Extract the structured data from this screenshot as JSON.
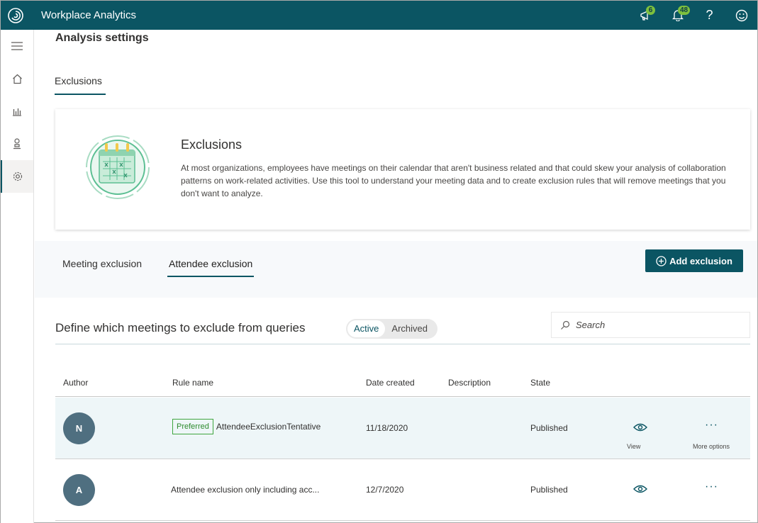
{
  "app": {
    "title": "Workplace Analytics"
  },
  "header": {
    "megaphone_count": "6",
    "bell_count": "48",
    "help_label": "?"
  },
  "page": {
    "title": "Analysis settings",
    "tab": "Exclusions"
  },
  "card": {
    "title": "Exclusions",
    "text": "At most organizations, employees have meetings on their calendar that aren't business related and that could skew your analysis of collaboration patterns on work-related activities. Use this tool to understand your meeting data and to create exclusion rules that will remove meetings that you don't want to analyze."
  },
  "subtabs": {
    "meeting": "Meeting exclusion",
    "attendee": "Attendee exclusion"
  },
  "add_button": "Add exclusion",
  "section": {
    "title": "Define which meetings to exclude from queries",
    "toggle_active": "Active",
    "toggle_archived": "Archived",
    "search_placeholder": "Search"
  },
  "table": {
    "columns": {
      "author": "Author",
      "rule": "Rule name",
      "date": "Date created",
      "description": "Description",
      "state": "State"
    },
    "rows": [
      {
        "initial": "N",
        "badge": "Preferred",
        "rule": "AttendeeExclusionTentative",
        "date": "11/18/2020",
        "state": "Published",
        "view_label": "View",
        "more_label": "More options"
      },
      {
        "initial": "A",
        "rule": "Attendee exclusion only including acc...",
        "date": "12/7/2020",
        "state": "Published"
      }
    ]
  },
  "colors": {
    "brand": "#0b5563",
    "badge": "#7dc03e",
    "avatar": "#4f6f80",
    "preferred": "#3fa63f"
  }
}
